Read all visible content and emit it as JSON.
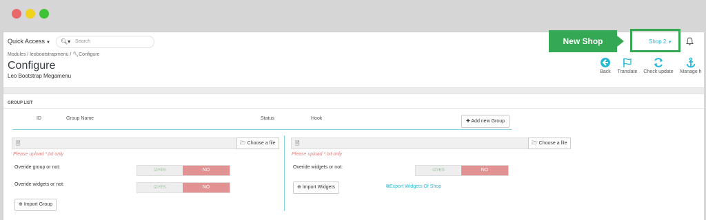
{
  "window": {
    "dots": [
      "#e8676b",
      "#f1d21d",
      "#3ec334"
    ]
  },
  "topbar": {
    "quick_access": "Quick Access",
    "search_placeholder": "Search",
    "shop_selector": "Shop 2"
  },
  "breadcrumb": {
    "items": [
      "Modules",
      "leobootstrapmenu",
      "Configure"
    ],
    "sep": "/"
  },
  "page": {
    "title": "Configure",
    "subtitle": "Leo Bootstrap Megamenu"
  },
  "toolbar": {
    "back": "Back",
    "translate": "Translate",
    "check_update": "Check update",
    "manage_hooks": "Manage h"
  },
  "callout": {
    "label": "New Shop"
  },
  "panel": {
    "heading": "GROUP LIST",
    "columns": {
      "id": "ID",
      "group_name": "Group Name",
      "status": "Status",
      "hook": "Hook"
    },
    "add_group": "Add new Group"
  },
  "left": {
    "choose_file": "Choose a file",
    "upload_note": "Please upload *.txt only",
    "override_group": "Overide group or not:",
    "override_widgets": "Overide widgets or not:",
    "yes": "YES",
    "no": "NO",
    "import_group": "Import Group"
  },
  "right": {
    "choose_file": "Choose a file",
    "upload_note": "Please upload *.txt only",
    "override_widgets": "Overide widgets or not:",
    "yes": "YES",
    "no": "NO",
    "import_widgets": "Import Widgets",
    "export_widgets": "Export Widgets Of Shop"
  }
}
